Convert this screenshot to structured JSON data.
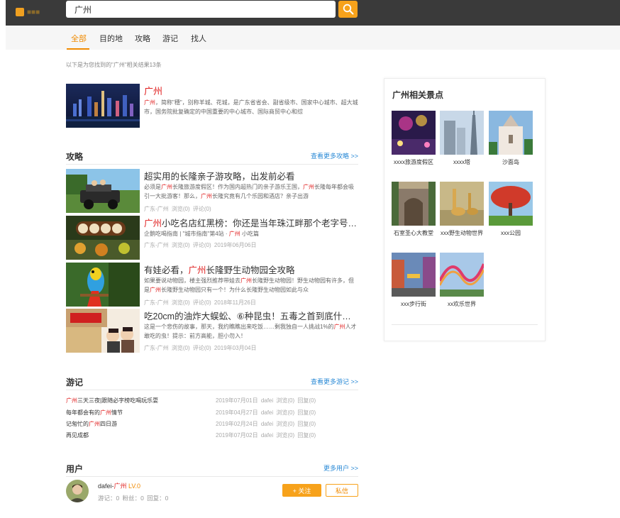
{
  "header": {
    "search_value": "广州"
  },
  "nav": {
    "tabs": [
      "全部",
      "目的地",
      "攻略",
      "游记",
      "找人"
    ],
    "active_index": 0
  },
  "results": {
    "summary": "以下是为您找到的\"广州\"相关结果13条"
  },
  "city": {
    "title": "广州",
    "desc_hl": "广州",
    "desc": "，简称\"穗\"，别称羊城、花城，是广东省省会、副省级市、国家中心城市、超大城市，国务院批复确定的中国重要的中心城市、国际商贸中心和综"
  },
  "guides_section": {
    "title": "攻略",
    "more": "查看更多攻略 >>",
    "items": [
      {
        "title": "超实用的长隆亲子游攻略，出发前必看",
        "desc": [
          "必须是",
          "广州",
          "长隆旅游度假区！作为国内超热门的亲子游乐王国，",
          "广州",
          "长隆每年都会吸引一大批游客！那么，",
          "广州",
          "长隆究竟有几个乐园和酒店？亲子出游"
        ],
        "meta": "广东-广州  浏览(0)  评论(0)"
      },
      {
        "title": [
          "广州",
          "小吃名店红黑榜：你还是当年珠江畔那个老字号吗？"
        ],
        "desc": [
          "企鹅吃喝指南 | \"城市指南\"第4站 · ",
          "广州",
          " 小吃篇"
        ],
        "meta": "广东-广州  浏览(0)  评论(0)  2019年06月06日"
      },
      {
        "title": [
          "有娃必看，",
          "广州",
          "长隆野生动物园全攻略"
        ],
        "desc": [
          "如果要说动物园，楼主强烈推荐带娃去",
          "广州",
          "长隆野生动物园！野生动物园有许多，但是",
          "广州",
          "长隆野生动物园只有一个！为什么长隆野生动物园如此与众"
        ],
        "meta": "广东-广州  浏览(0)  评论(0)  2018年11月26日"
      },
      {
        "title": "吃20cm的油炸大蜈蚣、⑥种昆虫！五毒之首到底什么味道？",
        "desc": [
          "这是一个悲伤的故事，那天，我约瞧瞧出来吃饭……剩我独自一人挑战1%的",
          "广州",
          "人才敢吃的虫！提示：前方高能，胆小勿入！"
        ],
        "meta": "广东-广州  浏览(0)  评论(0)  2019年03月04日"
      }
    ]
  },
  "notes_section": {
    "title": "游记",
    "more": "查看更多游记 >>",
    "items": [
      {
        "title": [
          "广州",
          "三天三夜|跟随必字榜吃喝玩乐耍"
        ],
        "meta": "2019年07月01日  dafei  浏览(0)  回复(0)"
      },
      {
        "title": [
          "每年都会有的",
          "广州",
          "情节"
        ],
        "meta": "2019年04月27日  dafei  浏览(0)  回复(0)"
      },
      {
        "title": [
          "记匆忙的",
          "广州",
          "四日游"
        ],
        "meta": "2019年02月24日  dafei  浏览(0)  回复(0)"
      },
      {
        "title": [
          "再见成都"
        ],
        "meta": "2019年07月02日  dafei  浏览(0)  回复(0)"
      }
    ]
  },
  "users_section": {
    "title": "用户",
    "more": "更多用户 >>",
    "user": {
      "name_prefix": "dafei-",
      "name_hl": "广州",
      "level": " LV.0",
      "stats": "游记：0  粉丝：0  回复：0",
      "follow_label": "+ 关注",
      "message_label": "私信"
    }
  },
  "sidebar": {
    "title": "广州相关景点",
    "spots": [
      {
        "name": "xxxx旅游度假区"
      },
      {
        "name": "xxxx塔"
      },
      {
        "name": "沙面岛"
      },
      {
        "name": "石室圣心大教堂"
      },
      {
        "name": "xxx野生动物世界"
      },
      {
        "name": "xxx公园"
      },
      {
        "name": "xxx步行街"
      },
      {
        "name": "xx欢乐世界"
      }
    ]
  },
  "colors": {
    "accent": "#f7a21b",
    "highlight": "#e02020",
    "link": "#2a8ad6",
    "topbar": "#3a3a3a"
  }
}
